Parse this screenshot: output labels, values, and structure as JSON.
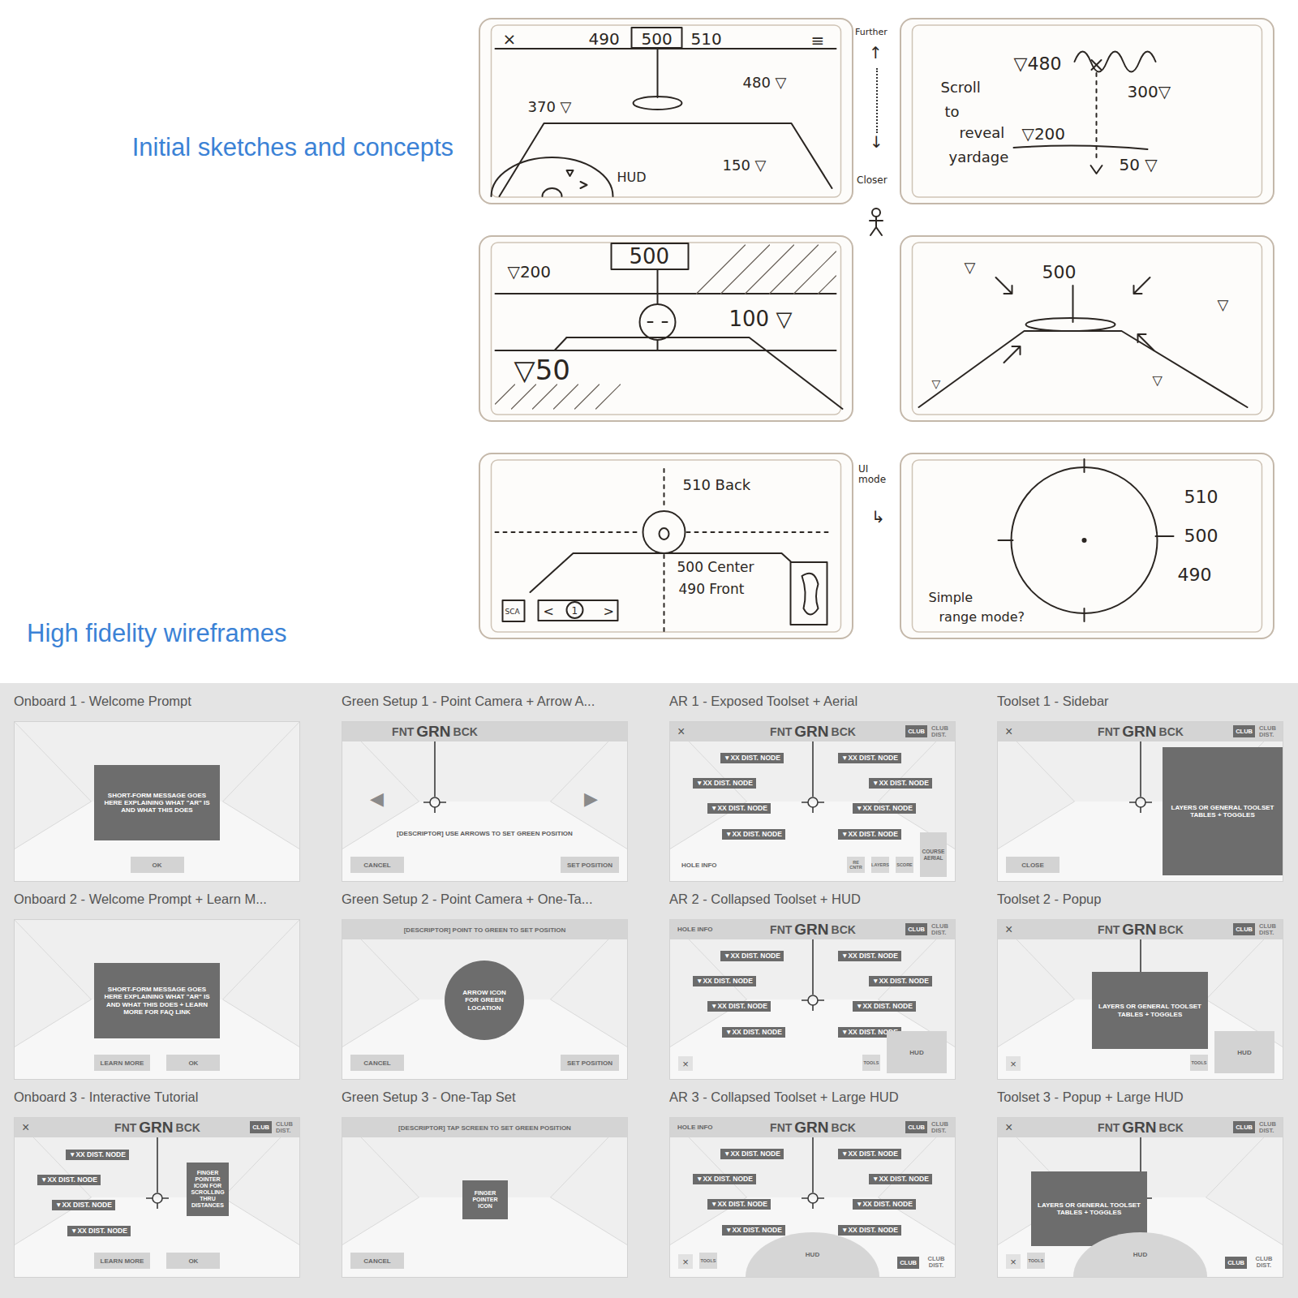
{
  "sketch_section": {
    "heading": "Initial sketches and concepts"
  },
  "sketches": [
    {
      "texts": [
        "×",
        "490",
        "500",
        "510",
        "≡",
        "480 ▽",
        "370 ▽",
        "150 ▽",
        "HUD"
      ]
    },
    {
      "texts": [
        "▽480",
        "Scroll",
        "to",
        "reveal",
        "yardage",
        "300▽",
        "▽200",
        "50 ▽"
      ]
    },
    {
      "texts": [
        "▽200",
        "500",
        "100 ▽",
        "▽50"
      ]
    },
    {
      "texts": [
        "▽",
        "500",
        "▽",
        "▽",
        "▽"
      ]
    },
    {
      "texts": [
        "510 Back",
        "500 Center",
        "490 Front",
        "SCA",
        "<",
        "1",
        ">"
      ]
    },
    {
      "texts": [
        "510",
        "500",
        "490",
        "Simple",
        "range mode?"
      ]
    }
  ],
  "annotations": {
    "further": "Further",
    "up": "↑",
    "down": "↓",
    "closer": "Closer",
    "ui_mode": "UI mode",
    "turn": "↳"
  },
  "wireframe_section": {
    "heading": "High fidelity wireframes"
  },
  "wireframes": [
    {
      "title": "Onboard 1 - Welcome Prompt",
      "pin": false,
      "crosshair": false,
      "panel": {
        "kind": "dialog",
        "text": "SHORT-FORM MESSAGE GOES HERE EXPLAINING WHAT \"AR\" IS AND WHAT THIS DOES"
      },
      "footer": {
        "left": [],
        "center": [
          {
            "label": "OK",
            "kind": "button"
          }
        ],
        "right": []
      }
    },
    {
      "title": "Green Setup 1 - Point Camera + Arrow A...",
      "pin": true,
      "crosshair": true,
      "header": {
        "brand": {
          "front": "FNT",
          "green": "GRN",
          "back": "BCK"
        }
      },
      "arrows": [
        "◀",
        "▶"
      ],
      "descriptor": "[DESCRIPTOR] USE ARROWS TO SET GREEN POSITION",
      "footer": {
        "left": [
          {
            "label": "CANCEL",
            "kind": "button"
          }
        ],
        "center": [],
        "right": [
          {
            "label": "SET POSITION",
            "kind": "button"
          }
        ]
      }
    },
    {
      "title": "AR 1 - Exposed Toolset + Aerial",
      "pin": true,
      "crosshair": true,
      "header": {
        "left": {
          "label": "×",
          "kind": "close"
        },
        "brand": {
          "front": "FNT",
          "green": "GRN",
          "back": "BCK"
        },
        "club": "CLUB",
        "club_dist": "CLUB DIST."
      },
      "nodes": [
        "▼XX DIST. NODE",
        "▼XX DIST. NODE",
        "▼XX DIST. NODE",
        "▼XX DIST. NODE",
        "▼XX DIST. NODE",
        "▼XX DIST. NODE",
        "▼XX DIST. NODE",
        "▼XX DIST. NODE"
      ],
      "footer": {
        "left": [
          {
            "label": "HOLE INFO",
            "kind": "text"
          }
        ],
        "center": [],
        "right": [
          {
            "label": "RE CNTR",
            "kind": "tiny"
          },
          {
            "label": "LAYERS",
            "kind": "tiny"
          },
          {
            "label": "SCORE",
            "kind": "tiny"
          },
          {
            "label": "COURSE AERIAL",
            "kind": "aerial"
          }
        ]
      }
    },
    {
      "title": "Toolset 1 - Sidebar",
      "pin": true,
      "crosshair": true,
      "header": {
        "left": {
          "label": "×",
          "kind": "close"
        },
        "brand": {
          "front": "FNT",
          "green": "GRN",
          "back": "BCK"
        },
        "club": "CLUB",
        "club_dist": "CLUB DIST."
      },
      "panel": {
        "kind": "sidebar",
        "text": "LAYERS OR GENERAL TOOLSET TABLES + TOGGLES"
      },
      "footer": {
        "left": [
          {
            "label": "CLOSE",
            "kind": "button"
          }
        ],
        "center": [],
        "right": []
      }
    },
    {
      "title": "Onboard 2 - Welcome Prompt + Learn M...",
      "pin": false,
      "crosshair": false,
      "panel": {
        "kind": "dialog",
        "text": "SHORT-FORM MESSAGE GOES HERE EXPLAINING WHAT \"AR\" IS AND WHAT THIS DOES + LEARN MORE FOR FAQ LINK"
      },
      "footer": {
        "left": [],
        "center": [
          {
            "label": "LEARN MORE",
            "kind": "button"
          },
          {
            "label": "OK",
            "kind": "button"
          }
        ],
        "right": []
      }
    },
    {
      "title": "Green Setup 2 - Point Camera + One-Ta...",
      "pin": false,
      "crosshair": false,
      "topbar": "[DESCRIPTOR] POINT TO GREEN TO SET POSITION",
      "panel": {
        "kind": "circle",
        "text": "ARROW ICON FOR GREEN LOCATION"
      },
      "footer": {
        "left": [
          {
            "label": "CANCEL",
            "kind": "button"
          }
        ],
        "center": [],
        "right": [
          {
            "label": "SET POSITION",
            "kind": "button"
          }
        ]
      }
    },
    {
      "title": "AR 2 - Collapsed Toolset + HUD",
      "pin": true,
      "crosshair": true,
      "header": {
        "left": {
          "label": "HOLE INFO",
          "kind": "text"
        },
        "brand": {
          "front": "FNT",
          "green": "GRN",
          "back": "BCK"
        },
        "club": "CLUB",
        "club_dist": "CLUB DIST."
      },
      "nodes": [
        "▼XX DIST. NODE",
        "▼XX DIST. NODE",
        "▼XX DIST. NODE",
        "▼XX DIST. NODE",
        "▼XX DIST. NODE",
        "▼XX DIST. NODE",
        "▼XX DIST. NODE",
        "▼XX DIST. NODE"
      ],
      "footer": {
        "left": [
          {
            "label": "×",
            "kind": "close"
          }
        ],
        "center": [],
        "right": [
          {
            "label": "TOOLS",
            "kind": "tiny"
          },
          {
            "label": "HUD",
            "kind": "hud"
          }
        ]
      }
    },
    {
      "title": "Toolset 2 - Popup",
      "pin": true,
      "crosshair": false,
      "header": {
        "left": {
          "label": "×",
          "kind": "close"
        },
        "brand": {
          "front": "FNT",
          "green": "GRN",
          "back": "BCK"
        },
        "club": "CLUB",
        "club_dist": "CLUB DIST."
      },
      "panel": {
        "kind": "popup",
        "text": "LAYERS OR GENERAL TOOLSET TABLES + TOGGLES"
      },
      "footer": {
        "left": [
          {
            "label": "×",
            "kind": "close"
          }
        ],
        "center": [],
        "right": [
          {
            "label": "TOOLS",
            "kind": "tiny"
          },
          {
            "label": "HUD",
            "kind": "hud"
          }
        ]
      }
    },
    {
      "title": "Onboard 3 - Interactive Tutorial",
      "pin": true,
      "crosshair": true,
      "header": {
        "left": {
          "label": "×",
          "kind": "close"
        },
        "brand": {
          "front": "FNT",
          "green": "GRN",
          "back": "BCK"
        },
        "club": "CLUB",
        "club_dist": "CLUB DIST."
      },
      "nodes": [
        "▼XX DIST. NODE",
        "▼XX DIST. NODE",
        "▼XX DIST. NODE",
        "▼XX DIST. NODE"
      ],
      "panel": {
        "kind": "icon",
        "text": "FINGER POINTER ICON FOR SCROLLING THRU DISTANCES"
      },
      "footer": {
        "left": [],
        "center": [
          {
            "label": "LEARN MORE",
            "kind": "button"
          },
          {
            "label": "OK",
            "kind": "button"
          }
        ],
        "right": []
      }
    },
    {
      "title": "Green Setup 3 - One-Tap Set",
      "pin": false,
      "crosshair": false,
      "topbar": "[DESCRIPTOR] TAP SCREEN TO SET GREEN POSITION",
      "panel": {
        "kind": "icon",
        "text": "FINGER POINTER ICON"
      },
      "footer": {
        "left": [
          {
            "label": "CANCEL",
            "kind": "button"
          }
        ],
        "center": [],
        "right": []
      }
    },
    {
      "title": "AR 3 - Collapsed Toolset + Large HUD",
      "pin": true,
      "crosshair": true,
      "header": {
        "left": {
          "label": "HOLE INFO",
          "kind": "text"
        },
        "brand": {
          "front": "FNT",
          "green": "GRN",
          "back": "BCK"
        },
        "club": "CLUB",
        "club_dist": "CLUB DIST."
      },
      "nodes": [
        "▼XX DIST. NODE",
        "▼XX DIST. NODE",
        "▼XX DIST. NODE",
        "▼XX DIST. NODE",
        "▼XX DIST. NODE",
        "▼XX DIST. NODE",
        "▼XX DIST. NODE",
        "▼XX DIST. NODE"
      ],
      "footer": {
        "left": [
          {
            "label": "×",
            "kind": "close"
          },
          {
            "label": "TOOLS",
            "kind": "tiny"
          }
        ],
        "center": [
          {
            "label": "HUD",
            "kind": "dome"
          }
        ],
        "right": [
          {
            "label": "CLUB",
            "kind": "club"
          },
          {
            "label": "CLUB DIST.",
            "kind": "clubdist"
          }
        ]
      }
    },
    {
      "title": "Toolset 3 - Popup + Large HUD",
      "pin": true,
      "crosshair": true,
      "header": {
        "left": {
          "label": "×",
          "kind": "close"
        },
        "brand": {
          "front": "FNT",
          "green": "GRN",
          "back": "BCK"
        },
        "club": "CLUB",
        "club_dist": "CLUB DIST."
      },
      "panel": {
        "kind": "popup",
        "text": "LAYERS OR GENERAL TOOLSET TABLES + TOGGLES"
      },
      "footer": {
        "left": [
          {
            "label": "×",
            "kind": "close"
          },
          {
            "label": "TOOLS",
            "kind": "tiny"
          }
        ],
        "center": [
          {
            "label": "HUD",
            "kind": "dome"
          }
        ],
        "right": [
          {
            "label": "CLUB",
            "kind": "club"
          },
          {
            "label": "CLUB DIST.",
            "kind": "clubdist"
          }
        ]
      }
    }
  ]
}
